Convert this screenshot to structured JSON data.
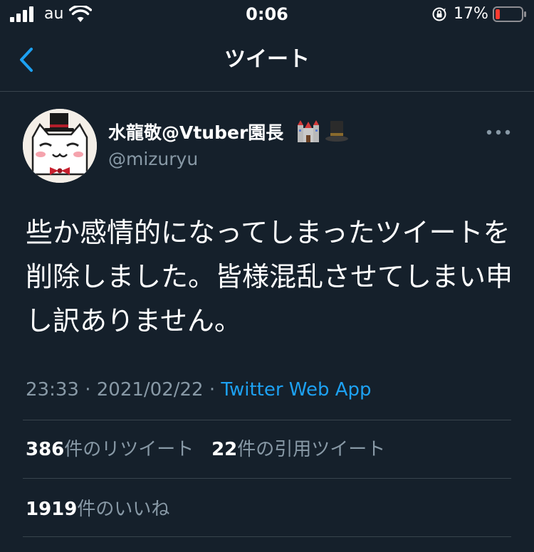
{
  "status_bar": {
    "carrier": "au",
    "time": "0:06",
    "battery_percent": "17%",
    "battery_level": 0.17,
    "battery_color": "#ff3b30"
  },
  "nav": {
    "title": "ツイート",
    "back_icon": "chevron-left-icon"
  },
  "tweet": {
    "display_name": "水龍敬@Vtuber園長",
    "name_emojis": [
      "castle-emoji",
      "top-hat-emoji"
    ],
    "handle": "@mizuryu",
    "text": "些か感情的になってしまったツイートを削除しました。皆様混乱させてしまい申し訳ありません。",
    "time": "23:33",
    "date": "2021/02/22",
    "separator": "·",
    "source": "Twitter Web App"
  },
  "stats": {
    "retweets_count": "386",
    "retweets_label": "件のリツイート",
    "quotes_count": "22",
    "quotes_label": "件の引用ツイート",
    "likes_count": "1919",
    "likes_label": "件のいいね"
  },
  "colors": {
    "background": "#15202b",
    "divider": "#38444d",
    "secondary_text": "#8899a6",
    "link": "#1da1f2"
  }
}
